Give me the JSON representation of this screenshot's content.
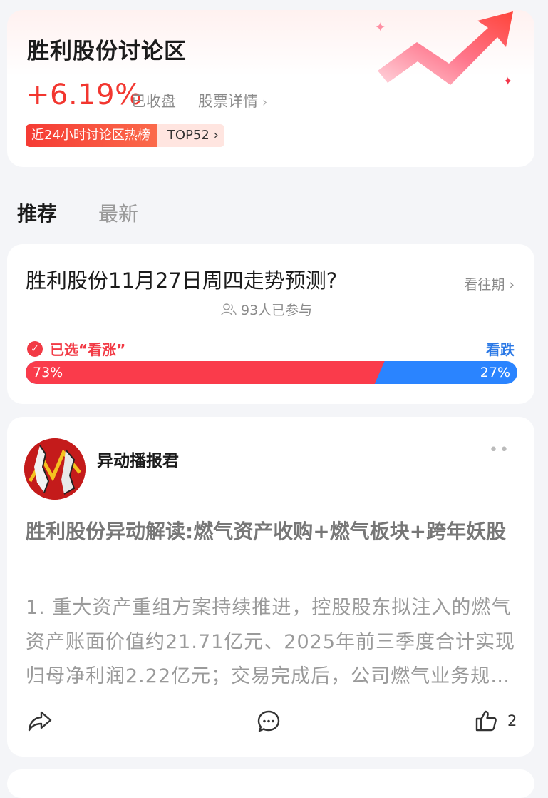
{
  "header": {
    "title": "胜利股份讨论区",
    "change": "+6.19%",
    "status": "已收盘",
    "detail_link": "股票详情",
    "hot_label": "近24小时讨论区热榜",
    "hot_rank": "TOP52"
  },
  "tabs": [
    {
      "label": "推荐"
    },
    {
      "label": "最新"
    }
  ],
  "poll": {
    "question": "胜利股份11月27日周四走势预测?",
    "past_link": "看往期",
    "participants": "93人已参与",
    "chosen_label": "已选“看涨”",
    "down_label": "看跌",
    "up_percent_text": "73%",
    "down_percent_text": "27%",
    "up_fraction": 0.73,
    "colors": {
      "up": "#fa3b4b",
      "down": "#2a84ff"
    }
  },
  "post": {
    "author": "异动播报君",
    "title": "胜利股份异动解读:燃气资产收购+燃气板块+跨年妖股",
    "body": "1. 重大资产重组方案持续推进，控股股东拟注入的燃气资产账面价值约21.71亿元、2025年前三季度合计实现归母净利润2.22亿元；交易完成后，公司燃气业务规模有望显著扩大。",
    "like_count": "2",
    "icons": [
      "share-icon",
      "comment-icon",
      "thumb-up-icon",
      "more-icon"
    ]
  }
}
